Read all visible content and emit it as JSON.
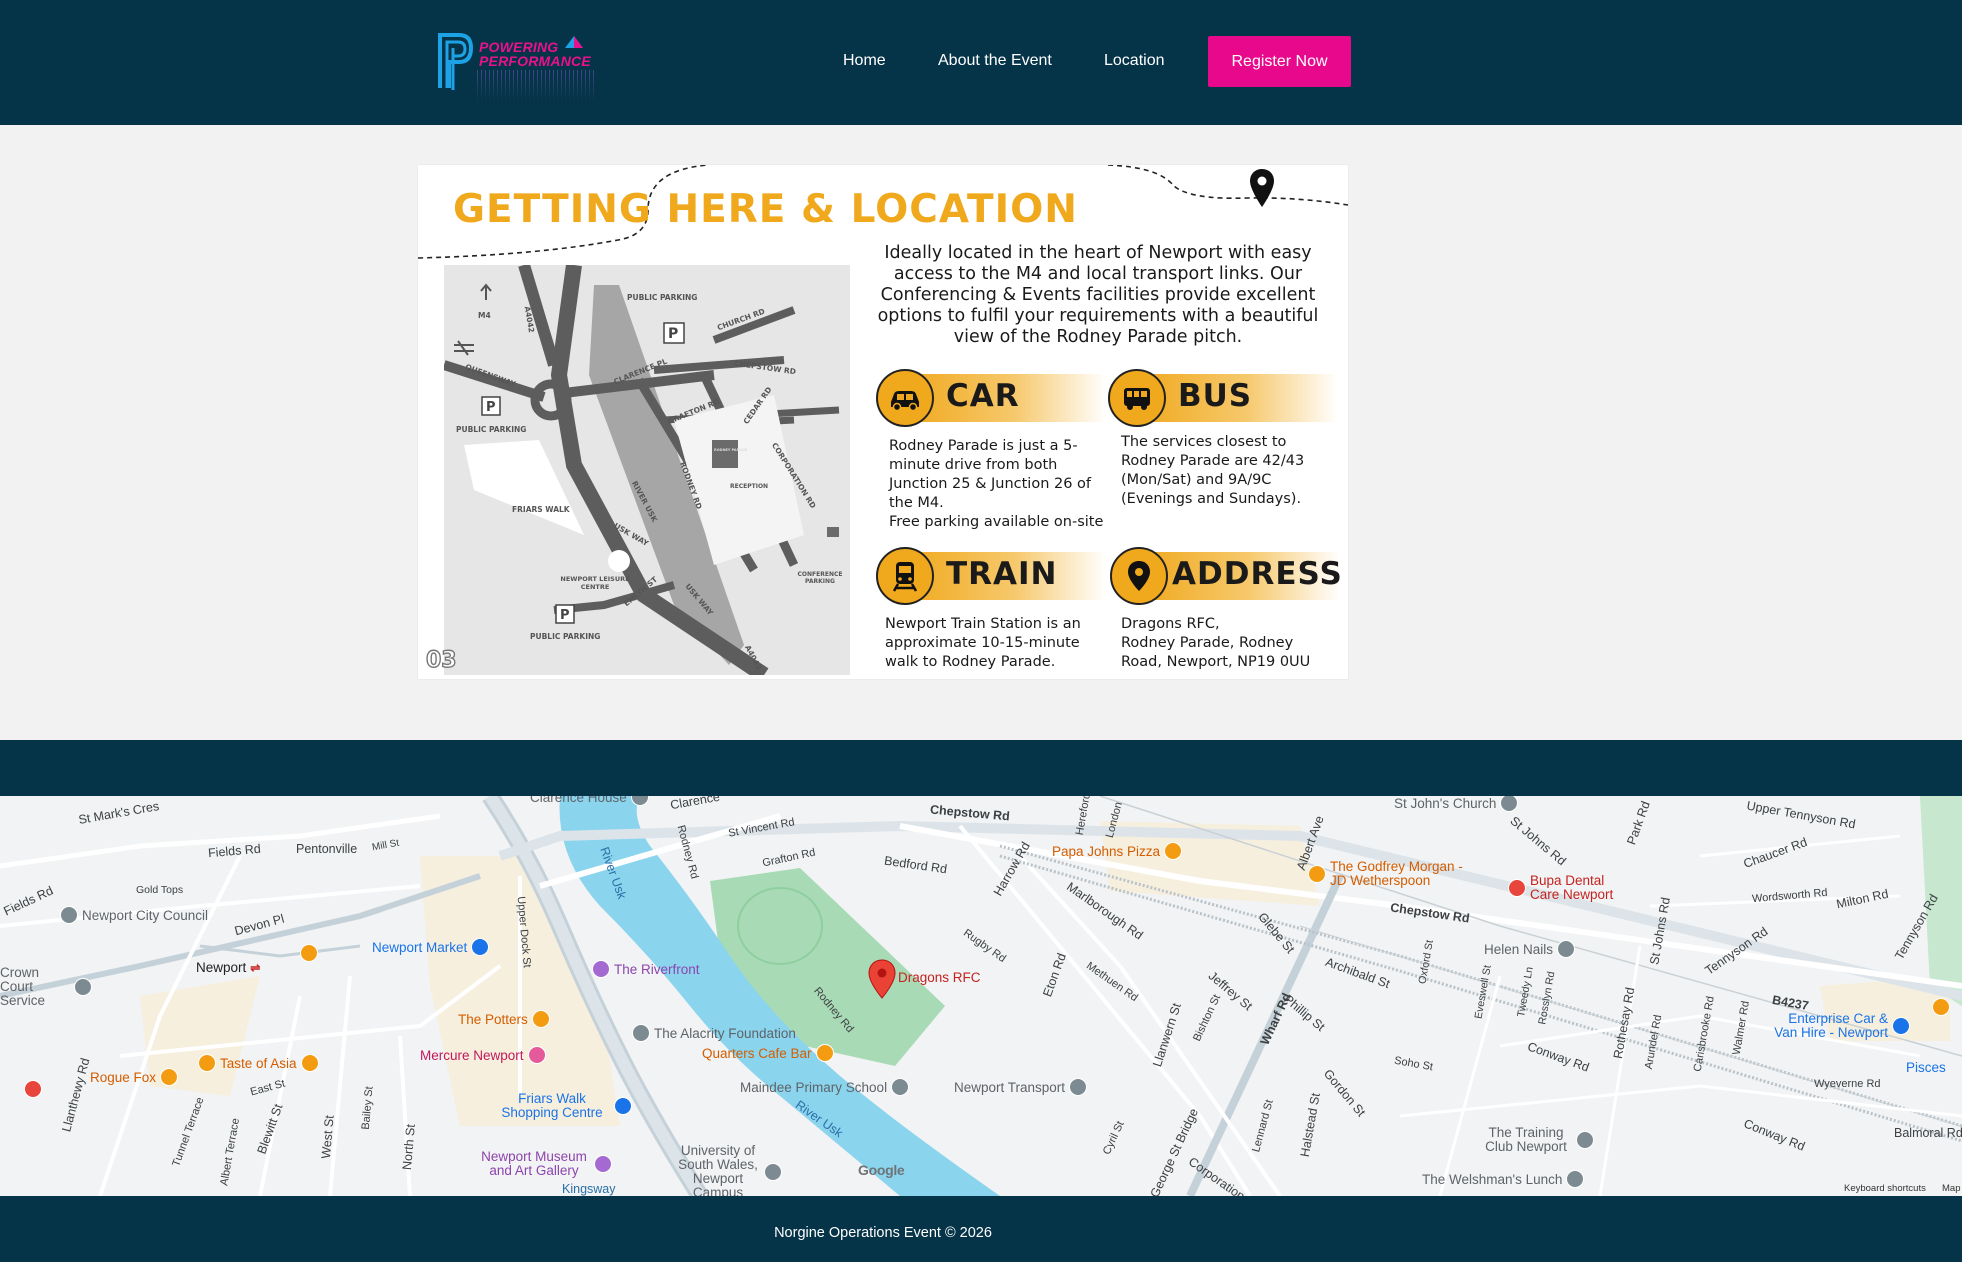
{
  "header": {
    "logo_line1": "POWERING",
    "logo_line2": "PERFORMANCE",
    "nav": [
      {
        "label": "Home"
      },
      {
        "label": "About the Event"
      },
      {
        "label": "Location"
      }
    ],
    "register_label": "Register Now"
  },
  "location_card": {
    "title": "GETTING HERE & LOCATION",
    "intro": "Ideally located in the heart of Newport with easy access to the M4 and local transport links. Our Conferencing & Events facilities provide excellent options to fulfil your requirements with a beautiful view of the Rodney Parade pitch.",
    "page_number": "03",
    "sections": [
      {
        "icon": "car-icon",
        "heading": "CAR",
        "lines": [
          "Rodney Parade is just a 5-",
          "minute drive from both",
          "Junction 25 & Junction 26 of",
          "the M4.",
          "Free parking available on-site"
        ]
      },
      {
        "icon": "bus-icon",
        "heading": "BUS",
        "lines": [
          "The services closest to",
          "Rodney Parade are 42/43",
          "(Mon/Sat) and 9A/9C",
          "(Evenings and Sundays)."
        ]
      },
      {
        "icon": "train-icon",
        "heading": "TRAIN",
        "lines": [
          "Newport Train Station is an",
          "approximate 10-15-minute",
          "walk to Rodney Parade."
        ]
      },
      {
        "icon": "location-pin-icon",
        "heading": "ADDRESS",
        "lines": [
          "Dragons RFC,",
          "Rodney Parade, Rodney",
          "Road, Newport, NP19 0UU"
        ]
      }
    ],
    "mini_map_labels": {
      "m4": "M4",
      "a4042_top": "A4042",
      "a4042_bottom": "A4042",
      "public_parking_top": "PUBLIC PARKING",
      "public_parking_left": "PUBLIC PARKING",
      "public_parking_bottom": "PUBLIC PARKING",
      "church_rd": "CHURCH RD",
      "chepstow_rd": "CHEPSTOW RD",
      "clarence_pl": "CLARENCE PL",
      "queensway": "QUEENSWAY",
      "grafton_rd": "GRAFTON RD",
      "cedar_rd": "CEDAR RD",
      "corporation_rd": "CORPORATION RD",
      "rodney_rd": "RODNEY RD",
      "river_usk": "RIVER USK",
      "usk_way": "USK WAY",
      "usk_way_2": "USK WAY",
      "reception": "RECEPTION",
      "friars_walk": "FRIARS WALK",
      "leisure_centre": "NEWPORT LEISURE CENTRE",
      "emlyn_st": "EMLYN ST",
      "conference_parking": "CONFERENCE PARKING",
      "rodney_parade": "RODNEY PARADE"
    }
  },
  "google_map": {
    "roads": [
      "St Mark's Cres",
      "Fields Rd",
      "Pentonville",
      "Mill St",
      "Gold Tops",
      "Fields Rd",
      "Devon Pl",
      "Clarence",
      "St Vincent Rd",
      "Rodney Rd",
      "Grafton Rd",
      "Chepstow Rd",
      "Bedford Rd",
      "Harrow Rd",
      "Marlborough Rd",
      "Rugby Rd",
      "Methuen Rd",
      "Eton Rd",
      "Llanwern St",
      "Jeffrey St",
      "Bishton St",
      "Wharf Rd",
      "Phillip St",
      "Glebe St",
      "Archibald St",
      "Chepstow Rd",
      "Albert Ave",
      "London",
      "Hereford",
      "Oxford St",
      "Eveswell St",
      "Tweedy Ln",
      "Rosslyn Rd",
      "St Johns Rd",
      "St Johns Rd",
      "Park Rd",
      "Upper Tennyson Rd",
      "Chaucer Rd",
      "Wordsworth Rd",
      "Milton Rd",
      "Tennyson Rd",
      "Tennyson Rd",
      "B4237",
      "Rothesay Rd",
      "Arundel Rd",
      "Carisbrooke Rd",
      "Walmer Rd",
      "Conway Rd",
      "Conway Rd",
      "Wyeverne Rd",
      "Balmoral Rd",
      "Soho St",
      "Gordon St",
      "Halstead St",
      "Lennard St",
      "Cyril St",
      "George St Bridge",
      "Corporation",
      "Upper Dock St",
      "River Usk",
      "River Usk",
      "Llanthewy Rd",
      "Tunnel Terrace",
      "Albert Terrace",
      "Blewitt St",
      "West St",
      "Bailey St",
      "North St",
      "East St",
      "Kingsway",
      "Rodney Rd"
    ],
    "pois": [
      {
        "name": "Newport City Council",
        "type": "civic"
      },
      {
        "name": "Newport",
        "type": "station"
      },
      {
        "name": "Newport Market",
        "type": "shopping"
      },
      {
        "name": "The Riverfront",
        "type": "venue"
      },
      {
        "name": "The Potters",
        "type": "bar"
      },
      {
        "name": "Mercure Newport",
        "type": "hotel"
      },
      {
        "name": "Taste of Asia",
        "type": "food"
      },
      {
        "name": "Rogue Fox",
        "type": "cafe"
      },
      {
        "name": "Friars Walk Shopping Centre",
        "type": "shopping"
      },
      {
        "name": "Newport Museum and Art Gallery",
        "type": "museum"
      },
      {
        "name": "University of South Wales, Newport Campus",
        "type": "school"
      },
      {
        "name": "The Alacrity Foundation",
        "type": "school"
      },
      {
        "name": "Quarters Cafe Bar",
        "type": "cafe"
      },
      {
        "name": "Maindee Primary School",
        "type": "school"
      },
      {
        "name": "Newport Transport",
        "type": "business"
      },
      {
        "name": "Dragons RFC",
        "type": "selected"
      },
      {
        "name": "Papa Johns Pizza",
        "type": "food"
      },
      {
        "name": "The Godfrey Morgan - JD Wetherspoon",
        "type": "bar"
      },
      {
        "name": "Bupa Dental Care Newport",
        "type": "health"
      },
      {
        "name": "Helen Nails",
        "type": "business"
      },
      {
        "name": "Enterprise Car & Van Hire - Newport",
        "type": "car"
      },
      {
        "name": "Pisces",
        "type": "shop"
      },
      {
        "name": "The Training Club Newport",
        "type": "business"
      },
      {
        "name": "The Welshman's Lunch",
        "type": "business"
      },
      {
        "name": "St John's Church",
        "type": "church"
      },
      {
        "name": "Crown Court Service",
        "type": "civic"
      },
      {
        "name": "Clarence House",
        "type": "business"
      }
    ],
    "google_logo": "Google",
    "keyboard_shortcuts": "Keyboard shortcuts",
    "map_data": "Map"
  },
  "footer": {
    "text": "Norgine Operations Event © 2026"
  },
  "colors": {
    "header_bg": "#053448",
    "accent_pink": "#e8088c",
    "location_gold": "#f0a81c"
  }
}
